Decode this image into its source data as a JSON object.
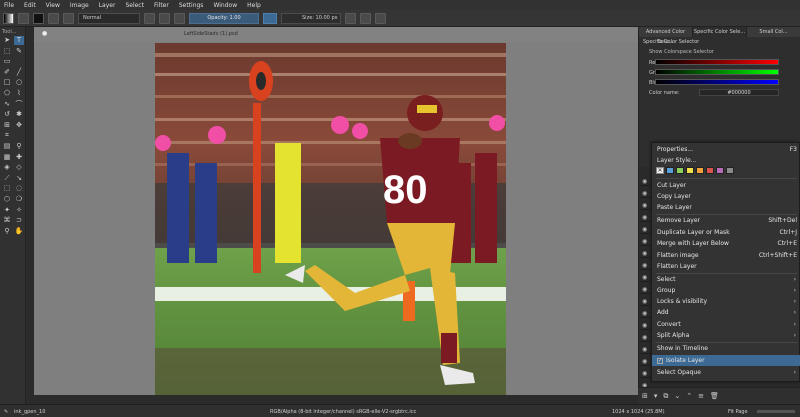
{
  "menu": [
    "File",
    "Edit",
    "View",
    "Image",
    "Layer",
    "Select",
    "Filter",
    "Settings",
    "Window",
    "Help"
  ],
  "toolbar": {
    "blend_mode": "Normal",
    "opacity": "Opacity:  1.00",
    "size": "Size:  10.00 px"
  },
  "toolbox": {
    "title": "Tool..."
  },
  "document": {
    "title": "LeftSideStadv (1).psd"
  },
  "dock": {
    "tabs": [
      "Advanced Color Sele...",
      "Specific Color Sele...",
      "Small Col..."
    ],
    "docker_title": "Specific Color Selector",
    "colorspace_label": "Show Colorspace Selector",
    "channels": [
      "Red:",
      "Green:",
      "Blue:"
    ],
    "color_name_label": "Color name:",
    "color_name_value": "#000000"
  },
  "context_menu": {
    "items": [
      {
        "label": "Properties...",
        "shortcut": "F3"
      },
      {
        "label": "Layer Style...",
        "shortcut": ""
      },
      {
        "label": "Cut Layer",
        "shortcut": ""
      },
      {
        "label": "Copy Layer",
        "shortcut": ""
      },
      {
        "label": "Paste Layer",
        "shortcut": ""
      },
      {
        "label": "Remove Layer",
        "shortcut": "Shift+Del"
      },
      {
        "label": "Duplicate Layer or Mask",
        "shortcut": "Ctrl+J"
      },
      {
        "label": "Merge with Layer Below",
        "shortcut": "Ctrl+E"
      },
      {
        "label": "Flatten image",
        "shortcut": "Ctrl+Shift+E"
      },
      {
        "label": "Flatten Layer",
        "shortcut": ""
      },
      {
        "label": "Select",
        "shortcut": ""
      },
      {
        "label": "Group",
        "shortcut": ""
      },
      {
        "label": "Locks & visibility",
        "shortcut": ""
      },
      {
        "label": "Add",
        "shortcut": ""
      },
      {
        "label": "Convert",
        "shortcut": ""
      },
      {
        "label": "Split Alpha",
        "shortcut": ""
      },
      {
        "label": "Show in Timeline",
        "shortcut": ""
      },
      {
        "label": "Isolate Layer",
        "shortcut": ""
      },
      {
        "label": "Select Opaque",
        "shortcut": ""
      }
    ],
    "swatch_colors": [
      "#5aa0d8",
      "#8ccf5a",
      "#f2e04a",
      "#f2a23c",
      "#d9534f",
      "#b86bb8",
      "#8b8b8b"
    ]
  },
  "photo": {
    "jersey_number": "80"
  },
  "status": {
    "brush": "ink_gpen_10",
    "color_info": "RGB/Alpha (8-bit integer/channel)  sRGB-elle-V2-srgbtrc.icc",
    "dimensions": "1024 x 1024 (25.8M)",
    "fit": "Fit Page"
  },
  "colors": {
    "accent": "#3d6a94",
    "background": "#2b2b2b"
  }
}
